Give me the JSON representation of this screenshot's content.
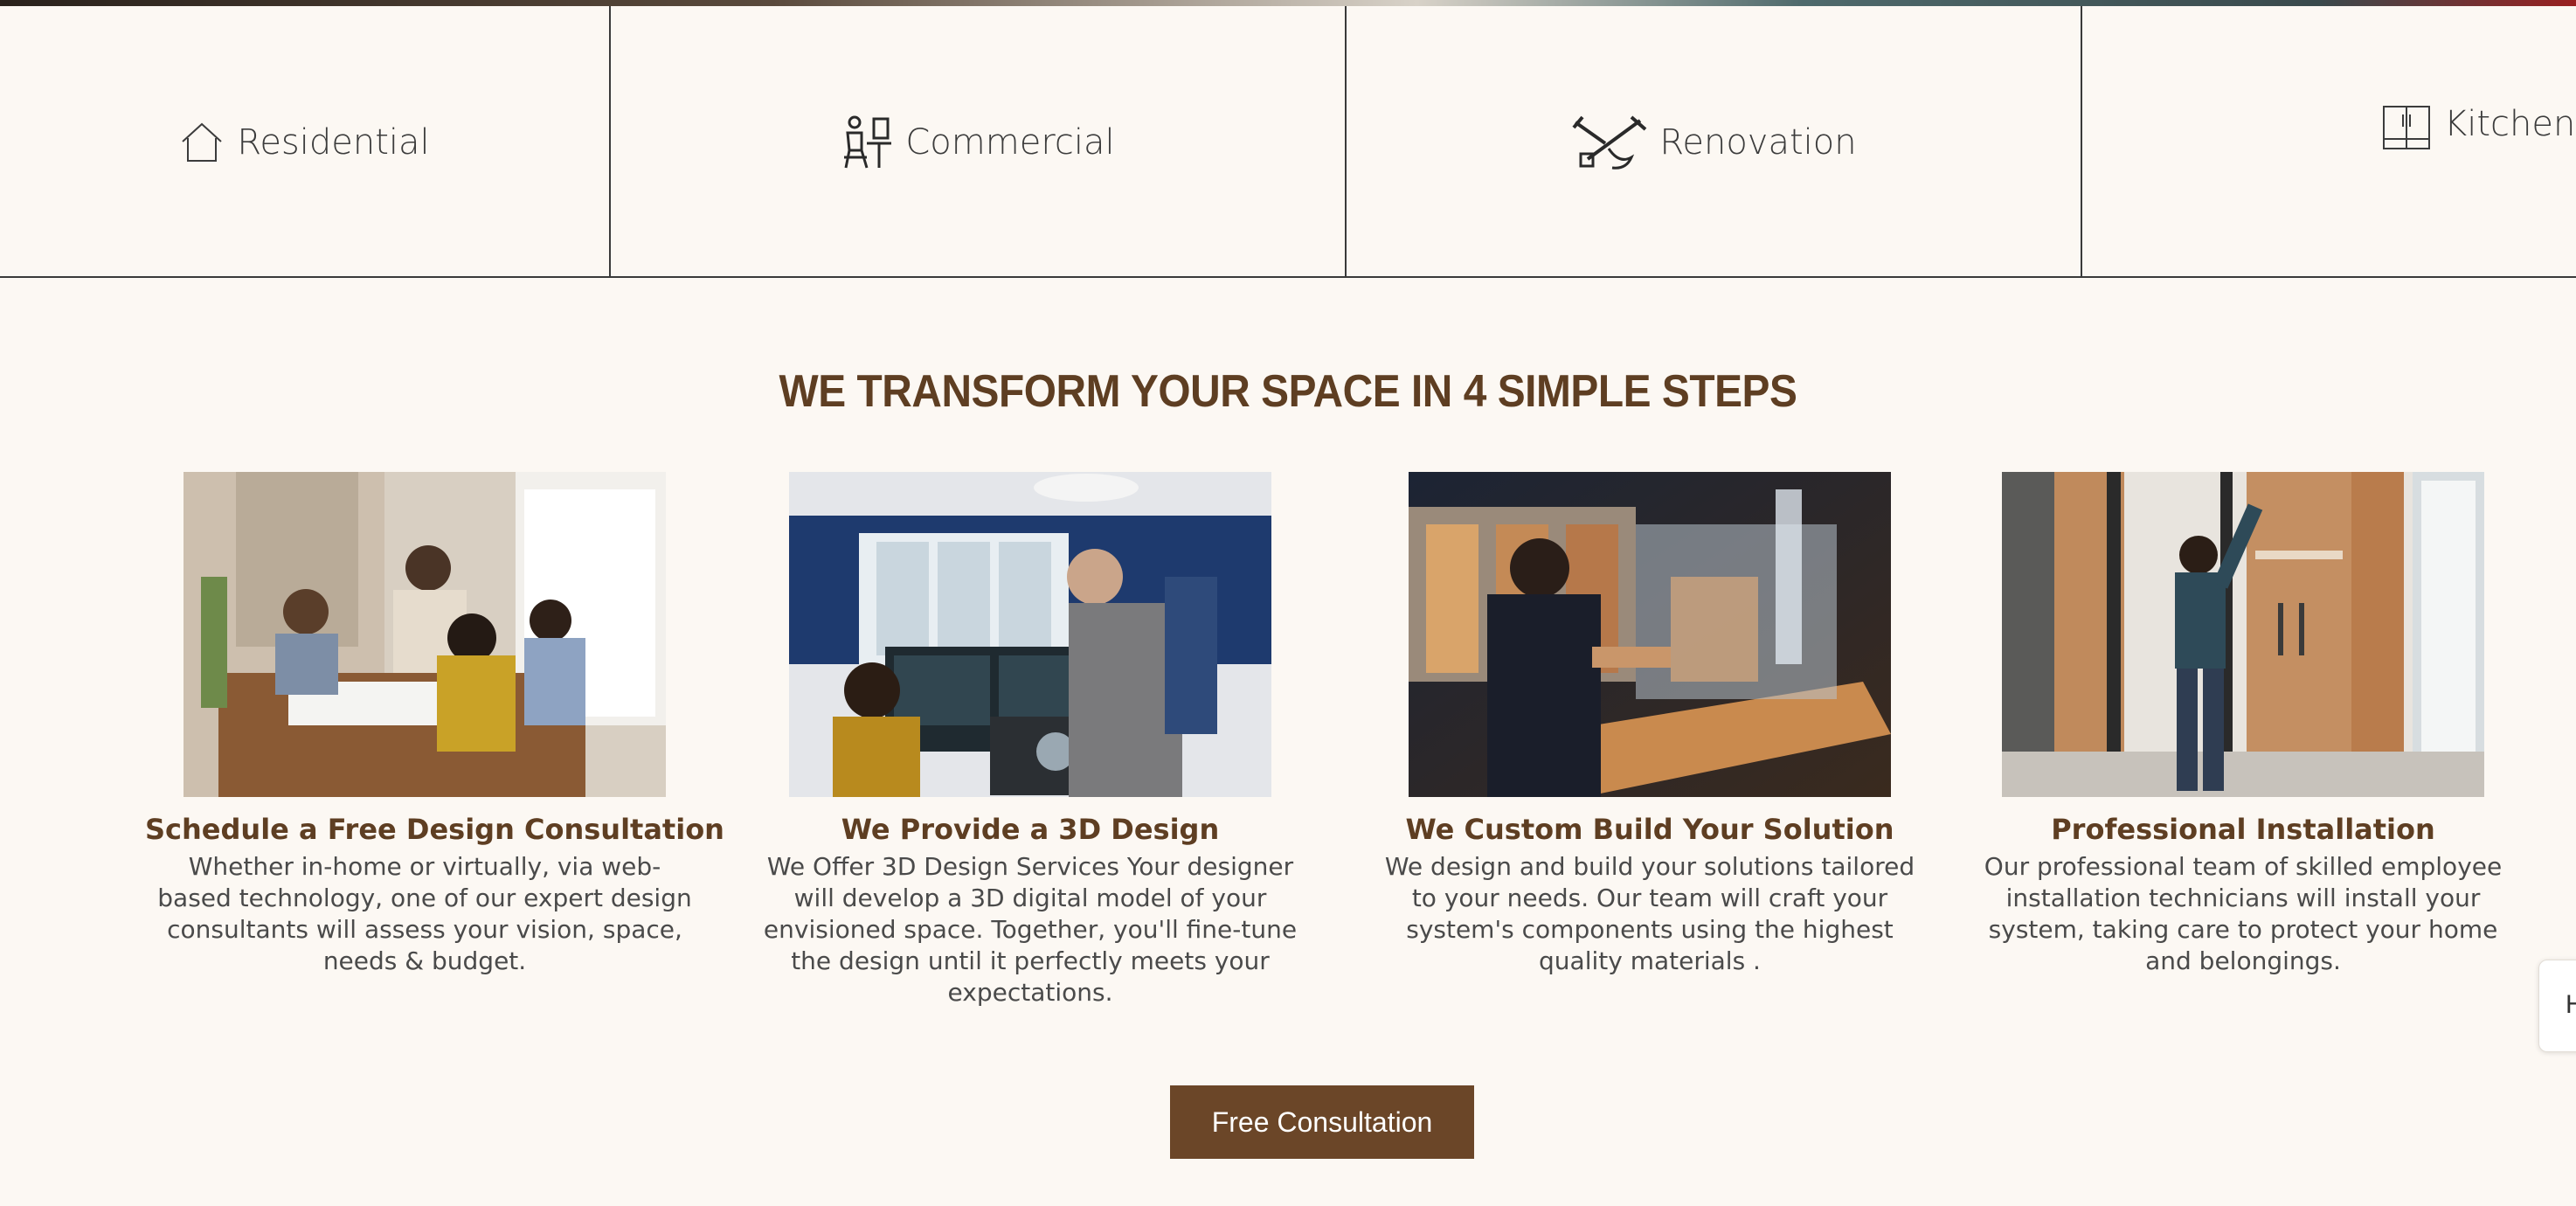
{
  "categories": [
    {
      "label": "Residential",
      "icon": "house-icon"
    },
    {
      "label": "Commercial",
      "icon": "desk-worker-icon"
    },
    {
      "label": "Renovation",
      "icon": "tools-icon"
    },
    {
      "label": "Kitchen",
      "icon": "cabinet-icon"
    }
  ],
  "headline": "WE TRANSFORM YOUR SPACE IN 4 SIMPLE STEPS",
  "steps": [
    {
      "title": "Schedule a Free Design Consultation",
      "description": "Whether in-home or virtually, via web-based technology, one of our expert design consultants will assess your vision, space, needs & budget."
    },
    {
      "title": "We Provide a 3D Design",
      "description": "We Offer 3D Design Services Your designer will develop a 3D digital model of your envisioned space. Together, you'll fine-tune the design until it perfectly meets your expectations."
    },
    {
      "title": "We Custom Build Your Solution",
      "description": "We design and build your solutions tailored to your needs. Our team will craft your system's components using the highest quality materials ."
    },
    {
      "title": "Professional Installation",
      "description": "Our professional team of skilled employee installation technicians will install your system, taking care to protect your home and belongings."
    }
  ],
  "cta_label": "Free Consultation",
  "side_tab_label": "H",
  "colors": {
    "accent": "#5e3e22",
    "button": "#6b4628",
    "background": "#fcf8f3"
  }
}
